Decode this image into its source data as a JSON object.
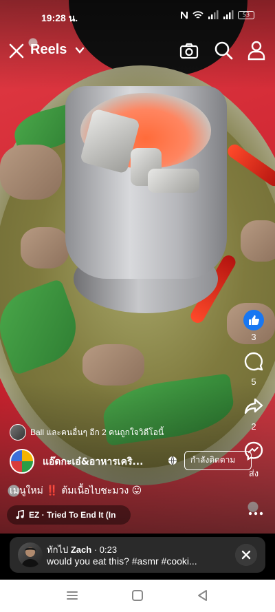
{
  "status_bar": {
    "time": "19:28 น.",
    "battery": "53"
  },
  "top_bar": {
    "title": "Reels",
    "icons": [
      "close-icon",
      "chevron-down-icon",
      "camera-icon",
      "search-icon",
      "person-icon"
    ]
  },
  "actions": {
    "like_count": "3",
    "comment_count": "5",
    "share_count": "2",
    "messenger_label": "ส่ง"
  },
  "post": {
    "friends_text": "Ball และคนอื่นๆ อีก 2 คนถูกใจวิดีโอนี้",
    "page_name": "แอ๊ดกะเอ๋&อาหารเคริ...",
    "follow_label": "กำลังติดตาม",
    "caption": "เมนูใหม่ ‼️ ต้มเนื้อไบชะมวง 😛",
    "music": "EZ · Tried To End It (In"
  },
  "comment_banner": {
    "prefix": "ทักไป",
    "name": "Zach",
    "time": "· 0:23",
    "text": "would you eat this? #asmr #cooki..."
  },
  "colors": {
    "like_blue": "#1877f2",
    "banner_bg": "#2a2a2a",
    "nav_bg": "#ffffff"
  }
}
